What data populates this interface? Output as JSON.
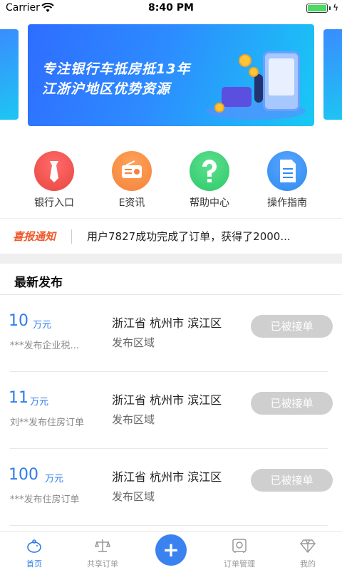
{
  "status_bar": {
    "carrier": "Carrier",
    "time": "8:40 PM",
    "battery_level": 1.0
  },
  "banner": {
    "line1": "专注银行车抵房抵13年",
    "line2": "江浙沪地区优势资源",
    "colors": {
      "start": "#2e6dff",
      "end": "#19c9f4"
    }
  },
  "quick_menu": [
    {
      "label": "银行入口",
      "icon": "tie-icon",
      "color": "#e8463f"
    },
    {
      "label": "E资讯",
      "icon": "radio-icon",
      "color": "#f5823a"
    },
    {
      "label": "帮助中心",
      "icon": "help-icon",
      "color": "#2fc96b"
    },
    {
      "label": "操作指南",
      "icon": "document-icon",
      "color": "#2f8bf0"
    }
  ],
  "notice": {
    "tag": "喜报通知",
    "text": "用户7827成功完成了订单，获得了2000..."
  },
  "section": {
    "title": "最新发布"
  },
  "orders": [
    {
      "amount": "10",
      "unit": "万元",
      "publisher": "***发布企业税...",
      "region": "浙江省 杭州市 滨江区",
      "region_label": "发布区域",
      "status": "已被接单"
    },
    {
      "amount": "11",
      "unit": "万元",
      "publisher": "刘**发布住房订单",
      "region": "浙江省 杭州市 滨江区",
      "region_label": "发布区域",
      "status": "已被接单"
    },
    {
      "amount": "100",
      "unit": "万元",
      "publisher": "***发布住房订单",
      "region": "浙江省 杭州市 滨江区",
      "region_label": "发布区域",
      "status": "已被接单"
    }
  ],
  "tabbar": {
    "tabs": [
      {
        "label": "首页",
        "icon": "piggy-bank-icon",
        "active": true
      },
      {
        "label": "共享订单",
        "icon": "scale-icon",
        "active": false
      },
      {
        "label": "订单管理",
        "icon": "safe-icon",
        "active": false
      },
      {
        "label": "我的",
        "icon": "diamond-icon",
        "active": false
      }
    ],
    "fab_symbol": "+",
    "active_color": "#2e7de8"
  }
}
